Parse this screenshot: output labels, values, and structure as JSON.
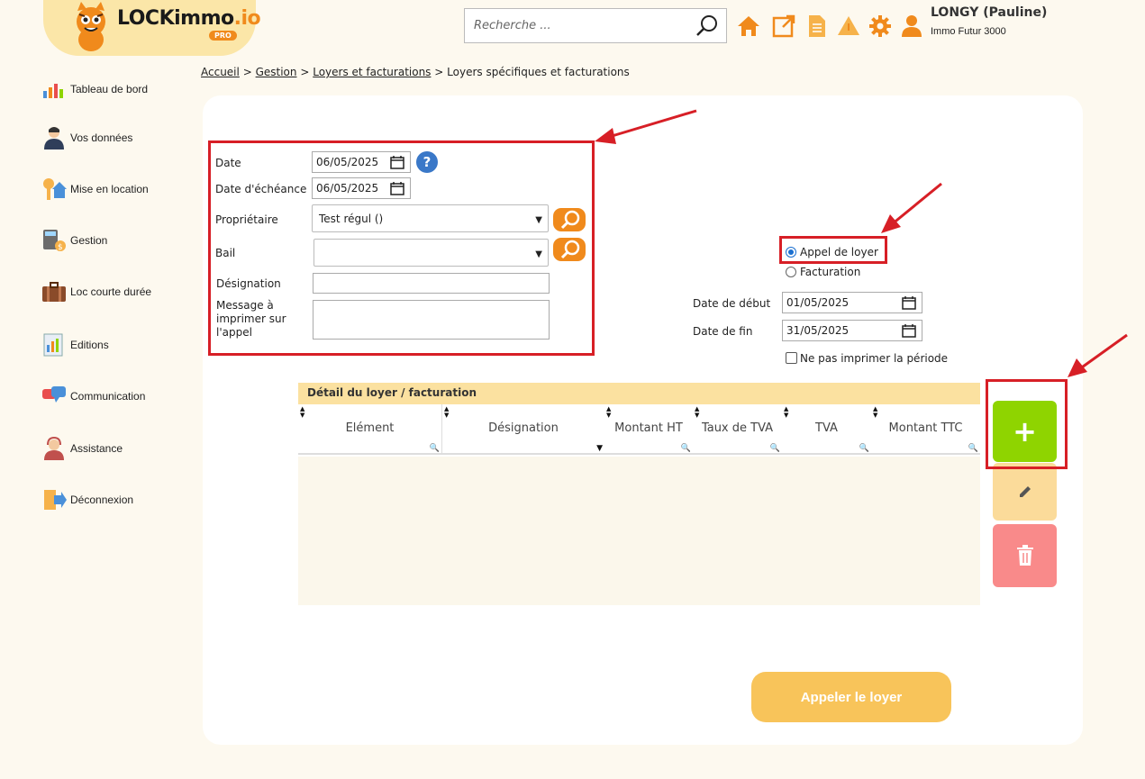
{
  "brand": {
    "name_main": "LOCKimmo",
    "name_suffix": ".io",
    "badge": "PRO"
  },
  "header": {
    "search_placeholder": "Recherche ...",
    "user_name": "LONGY (Pauline)",
    "user_company": "Immo Futur 3000",
    "icons": [
      "home-icon",
      "external-link-icon",
      "document-icon",
      "alert-icon",
      "gear-icon",
      "user-icon"
    ]
  },
  "sidebar": {
    "items": [
      {
        "label": "Tableau de bord",
        "icon": "dashboard-icon"
      },
      {
        "label": "Vos données",
        "icon": "person-icon"
      },
      {
        "label": "Mise en location",
        "icon": "key-house-icon"
      },
      {
        "label": "Gestion",
        "icon": "calculator-icon"
      },
      {
        "label": "Loc courte durée",
        "icon": "suitcase-icon"
      },
      {
        "label": "Editions",
        "icon": "report-icon"
      },
      {
        "label": "Communication",
        "icon": "chat-icon"
      },
      {
        "label": "Assistance",
        "icon": "support-icon"
      },
      {
        "label": "Déconnexion",
        "icon": "logout-icon"
      }
    ]
  },
  "breadcrumb": {
    "items": [
      "Accueil",
      "Gestion",
      "Loyers et facturations"
    ],
    "current": "Loyers spécifiques et facturations",
    "separator": ">"
  },
  "form": {
    "date_label": "Date",
    "date_value": "06/05/2025",
    "due_label": "Date d'échéance",
    "due_value": "06/05/2025",
    "owner_label": "Propriétaire",
    "owner_value": "Test régul ()",
    "lease_label": "Bail",
    "lease_value": "",
    "designation_label": "Désignation",
    "designation_value": "",
    "message_label": "Message à imprimer sur l'appel",
    "message_value": "",
    "help_glyph": "?"
  },
  "type": {
    "options": [
      "Appel de loyer",
      "Facturation"
    ],
    "selected": "Appel de loyer"
  },
  "period": {
    "start_label": "Date de début",
    "start_value": "01/05/2025",
    "end_label": "Date de fin",
    "end_value": "31/05/2025",
    "no_print_label": "Ne pas imprimer la période",
    "no_print_checked": false
  },
  "table": {
    "title": "Détail du loyer / facturation",
    "columns": [
      "Elément",
      "Désignation",
      "Montant HT",
      "Taux de TVA",
      "TVA",
      "Montant TTC"
    ],
    "rows": []
  },
  "actions": {
    "add_glyph": "+"
  },
  "submit_label": "Appeler le loyer",
  "colors": {
    "accent": "#f08a1c",
    "add": "#8fd400",
    "edit": "#fbdb9a",
    "delete": "#f98a8a",
    "annotation": "#d71f26"
  }
}
